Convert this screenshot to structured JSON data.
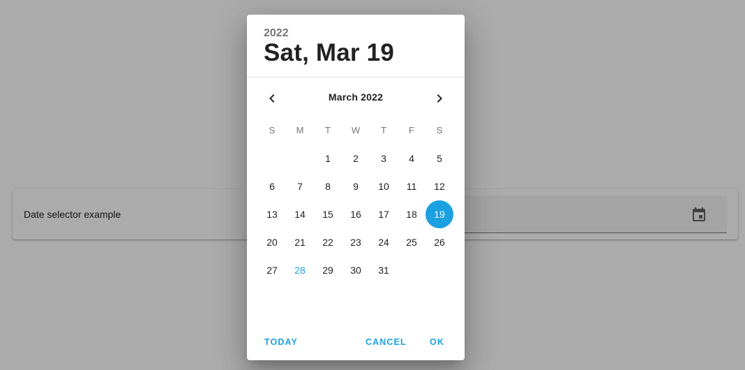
{
  "page": {
    "card_label": "Date selector example"
  },
  "dialog": {
    "year": "2022",
    "selected_date": "Sat, Mar 19",
    "month_label": "March 2022",
    "weekdays": [
      "S",
      "M",
      "T",
      "W",
      "T",
      "F",
      "S"
    ],
    "days": [
      "",
      "",
      "1",
      "2",
      "3",
      "4",
      "5",
      "6",
      "7",
      "8",
      "9",
      "10",
      "11",
      "12",
      "13",
      "14",
      "15",
      "16",
      "17",
      "18",
      "19",
      "20",
      "21",
      "22",
      "23",
      "24",
      "25",
      "26",
      "27",
      "28",
      "29",
      "30",
      "31"
    ],
    "selected_day": "19",
    "today_day": "28",
    "actions": {
      "today": "TODAY",
      "cancel": "CANCEL",
      "ok": "OK"
    }
  },
  "icons": {
    "field": "calendar-icon",
    "prev": "chevron-left-icon",
    "next": "chevron-right-icon"
  },
  "colors": {
    "accent": "#1ba1e2",
    "scrim": "rgba(0,0,0,0.33)",
    "text_primary": "#212121",
    "text_secondary": "#757575"
  }
}
